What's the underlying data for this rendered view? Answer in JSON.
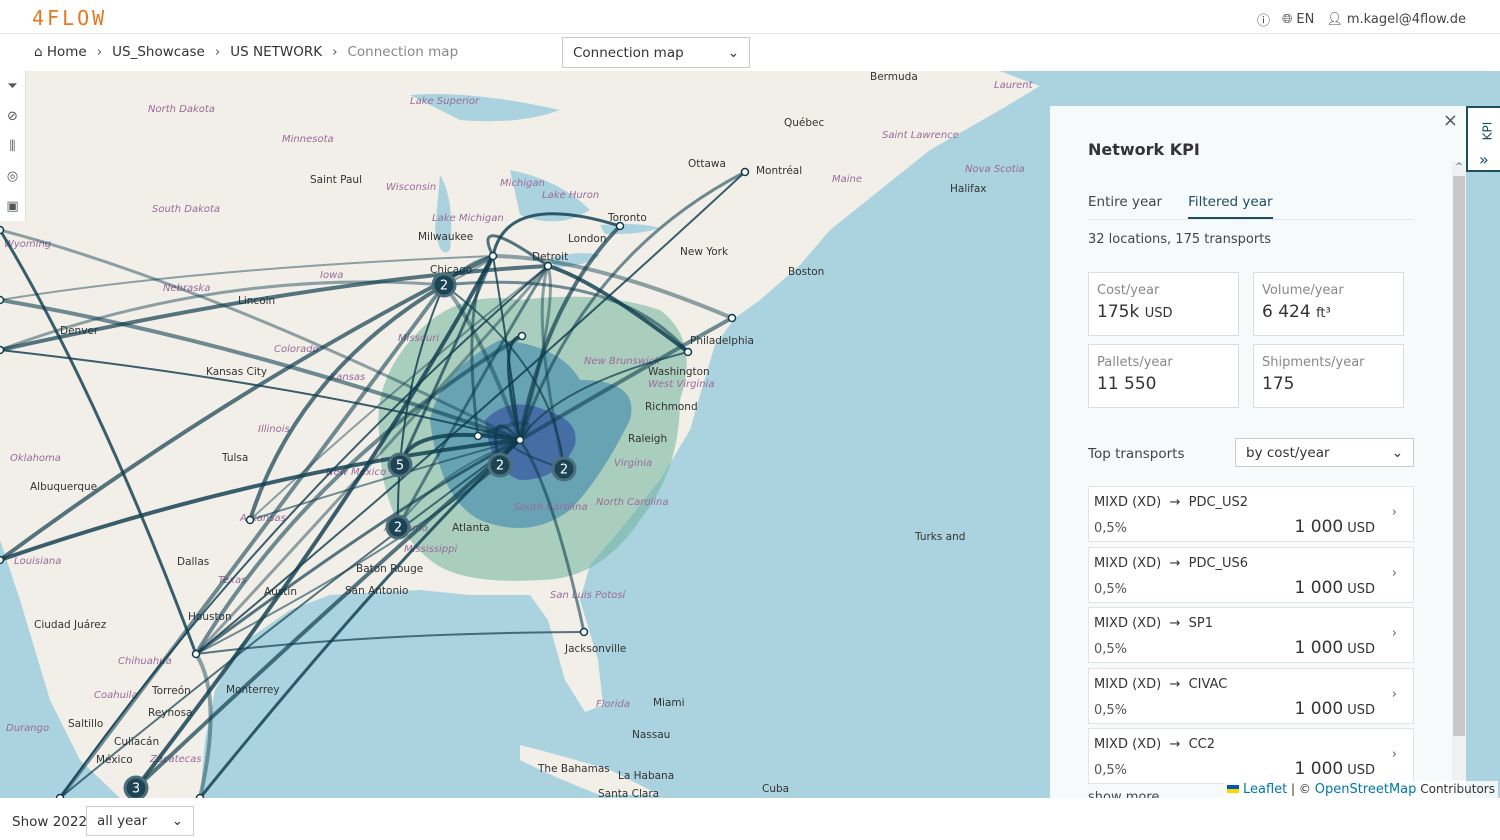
{
  "header": {
    "logo": "4FLOW",
    "help_icon": "help-circle-icon",
    "language": "EN",
    "user": "m.kagel@4flow.de"
  },
  "breadcrumb": [
    "Home",
    "US_Showcase",
    "US NETWORK",
    "Connection map"
  ],
  "view_select": {
    "value": "Connection map"
  },
  "tools": [
    "filter-icon",
    "eye-off-icon",
    "sliders-icon",
    "location-pin-icon",
    "camera-icon"
  ],
  "map": {
    "colors": {
      "route": "#0d3b4c",
      "water": "#aad3df",
      "land": "#f2efe9",
      "catchment_light": "#6fb39a",
      "catchment_dark": "#3a55a0"
    },
    "labels": [
      {
        "t": "North Dakota",
        "k": "it"
      },
      {
        "t": "Minnesota",
        "k": "it"
      },
      {
        "t": "Saint Paul",
        "k": "city"
      },
      {
        "t": "Wisconsin",
        "k": "it"
      },
      {
        "t": "Michigan",
        "k": "it"
      },
      {
        "t": "South Dakota",
        "k": "it"
      },
      {
        "t": "Wyoming",
        "k": "it"
      },
      {
        "t": "Lake Superior",
        "k": "it"
      },
      {
        "t": "Lake Huron",
        "k": "it"
      },
      {
        "t": "Lake Michigan",
        "k": "it"
      },
      {
        "t": "Milwaukee",
        "k": "city"
      },
      {
        "t": "Chicago",
        "k": "city"
      },
      {
        "t": "Detroit",
        "k": "city"
      },
      {
        "t": "Toronto",
        "k": "city"
      },
      {
        "t": "London",
        "k": "city"
      },
      {
        "t": "Ottawa",
        "k": "city"
      },
      {
        "t": "Montréal",
        "k": "city"
      },
      {
        "t": "Québec",
        "k": "city"
      },
      {
        "t": "Maine",
        "k": "it"
      },
      {
        "t": "Boston",
        "k": "city"
      },
      {
        "t": "New York",
        "k": "city"
      },
      {
        "t": "Philadelphia",
        "k": "city"
      },
      {
        "t": "Washington",
        "k": "city"
      },
      {
        "t": "Richmond",
        "k": "city"
      },
      {
        "t": "Raleigh",
        "k": "city"
      },
      {
        "t": "Halifax",
        "k": "city"
      },
      {
        "t": "Nova Scotia",
        "k": "it"
      },
      {
        "t": "Iowa",
        "k": "it"
      },
      {
        "t": "Nebraska",
        "k": "it"
      },
      {
        "t": "Lincoln",
        "k": "city"
      },
      {
        "t": "Denver",
        "k": "city"
      },
      {
        "t": "Colorado",
        "k": "it"
      },
      {
        "t": "Kansas City",
        "k": "city"
      },
      {
        "t": "Kansas",
        "k": "it"
      },
      {
        "t": "Missouri",
        "k": "it"
      },
      {
        "t": "Illinois",
        "k": "it"
      },
      {
        "t": "Tulsa",
        "k": "city"
      },
      {
        "t": "Oklahoma",
        "k": "it"
      },
      {
        "t": "Albuquerque",
        "k": "city"
      },
      {
        "t": "New Mexico",
        "k": "it"
      },
      {
        "t": "Arkansas",
        "k": "it"
      },
      {
        "t": "Dallas",
        "k": "city"
      },
      {
        "t": "Texas",
        "k": "it"
      },
      {
        "t": "Austin",
        "k": "city"
      },
      {
        "t": "Houston",
        "k": "city"
      },
      {
        "t": "San Antonio",
        "k": "city"
      },
      {
        "t": "Baton Rouge",
        "k": "city"
      },
      {
        "t": "Louisiana",
        "k": "it"
      },
      {
        "t": "Ciudad Juárez",
        "k": "city"
      },
      {
        "t": "Chihuahua",
        "k": "it"
      },
      {
        "t": "Coahuila",
        "k": "it"
      },
      {
        "t": "Torreón",
        "k": "city"
      },
      {
        "t": "Monterrey",
        "k": "city"
      },
      {
        "t": "Reynosa",
        "k": "city"
      },
      {
        "t": "Saltillo",
        "k": "city"
      },
      {
        "t": "Durango",
        "k": "it"
      },
      {
        "t": "Culiacán",
        "k": "city"
      },
      {
        "t": "México",
        "k": "city"
      },
      {
        "t": "Zacatecas",
        "k": "it"
      },
      {
        "t": "San Luis Potosí",
        "k": "it"
      },
      {
        "t": "Jacksonville",
        "k": "city"
      },
      {
        "t": "Florida",
        "k": "it"
      },
      {
        "t": "Miami",
        "k": "city"
      },
      {
        "t": "Nassau",
        "k": "city"
      },
      {
        "t": "The Bahamas",
        "k": "city"
      },
      {
        "t": "La Habana",
        "k": "city"
      },
      {
        "t": "Santa Clara",
        "k": "city"
      },
      {
        "t": "Cuba",
        "k": "city"
      },
      {
        "t": "Turks and",
        "k": "city"
      },
      {
        "t": "Bermuda",
        "k": "city"
      },
      {
        "t": "Laurent",
        "k": "it"
      },
      {
        "t": "Saint Lawrence",
        "k": "it"
      },
      {
        "t": "New Brunswick",
        "k": "it"
      },
      {
        "t": "West Virginia",
        "k": "it"
      },
      {
        "t": "Virginia",
        "k": "it"
      },
      {
        "t": "North Carolina",
        "k": "it"
      },
      {
        "t": "South Carolina",
        "k": "it"
      },
      {
        "t": "Atlanta",
        "k": "city"
      },
      {
        "t": "Alabama",
        "k": "it"
      },
      {
        "t": "Mississippi",
        "k": "it"
      }
    ],
    "clusters": [
      2,
      5,
      2,
      2,
      2,
      3
    ]
  },
  "kpi_panel": {
    "title": "Network KPI",
    "tabs": [
      {
        "label": "Entire year",
        "active": false
      },
      {
        "label": "Filtered year",
        "active": true
      }
    ],
    "summary": "32 locations, 175 transports",
    "cards": [
      {
        "label": "Cost/year",
        "value": "175k",
        "unit": "USD"
      },
      {
        "label": "Volume/year",
        "value": "6 424",
        "unit": "ft³"
      },
      {
        "label": "Pallets/year",
        "value": "11 550",
        "unit": ""
      },
      {
        "label": "Shipments/year",
        "value": "175",
        "unit": ""
      }
    ],
    "top_label": "Top transports",
    "sort_select": {
      "value": "by cost/year"
    },
    "transports": [
      {
        "from": "MIXD (XD)",
        "to": "PDC_US2",
        "share": "0,5%",
        "amount": "1 000",
        "unit": "USD"
      },
      {
        "from": "MIXD (XD)",
        "to": "PDC_US6",
        "share": "0,5%",
        "amount": "1 000",
        "unit": "USD"
      },
      {
        "from": "MIXD (XD)",
        "to": "SP1",
        "share": "0,5%",
        "amount": "1 000",
        "unit": "USD"
      },
      {
        "from": "MIXD (XD)",
        "to": "CIVAC",
        "share": "0,5%",
        "amount": "1 000",
        "unit": "USD"
      },
      {
        "from": "MIXD (XD)",
        "to": "CC2",
        "share": "0,5%",
        "amount": "1 000",
        "unit": "USD"
      }
    ],
    "show_more": "show more",
    "side_tab": "KPI"
  },
  "attribution": {
    "leaflet": "Leaflet",
    "osm": "OpenStreetMap",
    "contributors": "Contributors"
  },
  "footer": {
    "show_label": "Show 2022",
    "period_select": {
      "value": "all year"
    }
  }
}
